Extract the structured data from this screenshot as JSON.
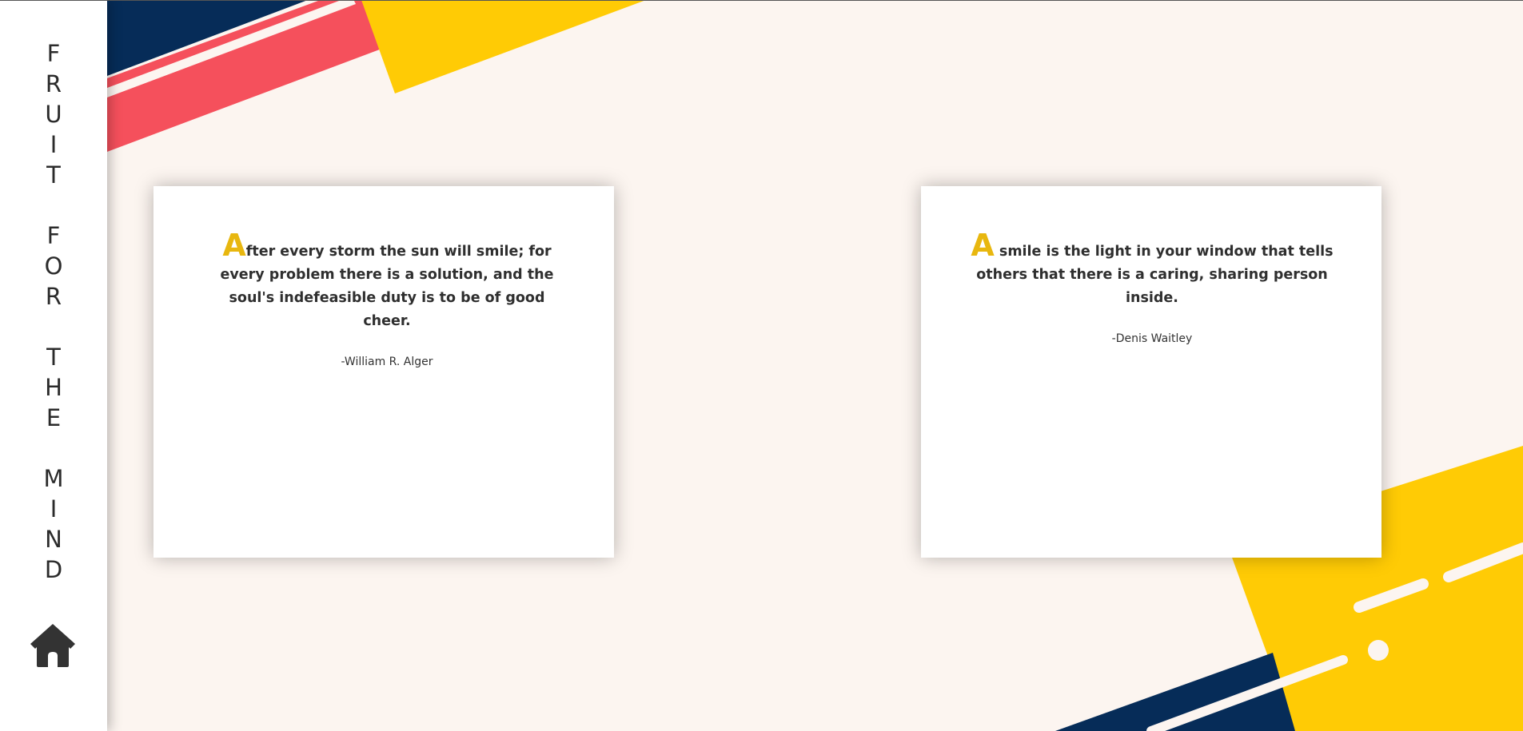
{
  "sidebar": {
    "title_letters": [
      "F",
      "R",
      "U",
      "I",
      "T",
      " ",
      "F",
      "O",
      "R",
      " ",
      "T",
      "H",
      "E",
      " ",
      "M",
      "I",
      "N",
      "D"
    ]
  },
  "quotes": [
    {
      "dropcap": "A",
      "text": "fter every storm the sun will smile; for every problem there is a solution, and the soul's indefeasible duty is to be of good cheer.",
      "author": "-William R. Alger"
    },
    {
      "dropcap": "A",
      "text": "smile is the light in your window that tells others that there is a caring, sharing person inside.",
      "author": "-Denis Waitley"
    }
  ],
  "icons": {
    "home": "home-icon"
  },
  "colors": {
    "background": "#fcf5f0",
    "accent_yellow": "#ffcb05",
    "accent_red": "#f5505c",
    "accent_navy": "#062c58",
    "dropcap": "#e8b70f"
  }
}
